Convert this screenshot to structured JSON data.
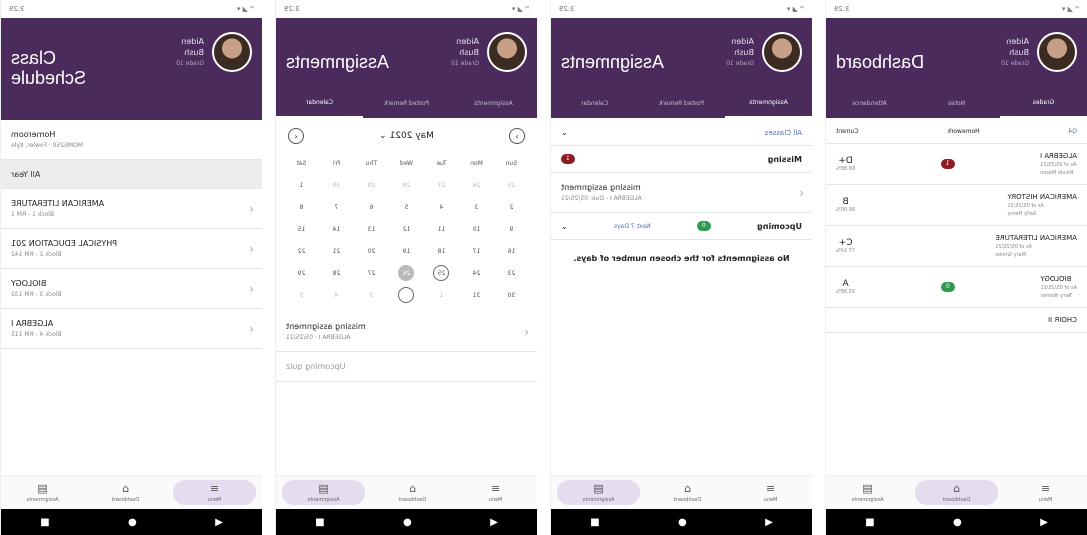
{
  "status": {
    "left": "ᴹ ◢ ▾",
    "right": "3:29"
  },
  "user": {
    "first": "Aiden",
    "last": "Bush",
    "grade": "Grade 10"
  },
  "screen1": {
    "title_line1": "Class",
    "title_line2": "Schedule",
    "homeroom": {
      "name": "Homeroom",
      "sub": "MOMS250 · Fowler, Kyle"
    },
    "term": "All Year",
    "classes": [
      {
        "name": "AMERICAN LITERATURE",
        "sub": "Block 1 - RM 1"
      },
      {
        "name": "PHYSICAL EDUCATION 201",
        "sub": "Block 2 - RM 142"
      },
      {
        "name": "BIOLOGY",
        "sub": "Block 3 - RM 132"
      },
      {
        "name": "ALGEBRA I",
        "sub": "Block 4 - RM 115"
      }
    ],
    "nav": [
      "Assignments",
      "Dashboard",
      "Menu"
    ]
  },
  "screen2": {
    "title": "Assignments",
    "tabs": [
      "Calendar",
      "Posted Remark",
      "Assignments"
    ],
    "month": "May 2021",
    "weekdays": [
      "Sun",
      "Mon",
      "Tue",
      "Wed",
      "Thu",
      "Fri",
      "Sat"
    ],
    "days": [
      {
        "d": "25",
        "s": "faded"
      },
      {
        "d": "26",
        "s": "faded"
      },
      {
        "d": "27",
        "s": "faded"
      },
      {
        "d": "28",
        "s": "faded"
      },
      {
        "d": "29",
        "s": "faded"
      },
      {
        "d": "30",
        "s": "faded"
      },
      {
        "d": "1",
        "s": ""
      },
      {
        "d": "2",
        "s": ""
      },
      {
        "d": "3",
        "s": ""
      },
      {
        "d": "4",
        "s": ""
      },
      {
        "d": "5",
        "s": ""
      },
      {
        "d": "6",
        "s": ""
      },
      {
        "d": "7",
        "s": ""
      },
      {
        "d": "8",
        "s": ""
      },
      {
        "d": "9",
        "s": ""
      },
      {
        "d": "10",
        "s": ""
      },
      {
        "d": "11",
        "s": ""
      },
      {
        "d": "12",
        "s": ""
      },
      {
        "d": "13",
        "s": ""
      },
      {
        "d": "14",
        "s": ""
      },
      {
        "d": "15",
        "s": ""
      },
      {
        "d": "16",
        "s": ""
      },
      {
        "d": "17",
        "s": ""
      },
      {
        "d": "18",
        "s": ""
      },
      {
        "d": "19",
        "s": ""
      },
      {
        "d": "20",
        "s": ""
      },
      {
        "d": "21",
        "s": ""
      },
      {
        "d": "22",
        "s": ""
      },
      {
        "d": "23",
        "s": ""
      },
      {
        "d": "24",
        "s": ""
      },
      {
        "d": "25",
        "s": "ring"
      },
      {
        "d": "26",
        "s": "sel"
      },
      {
        "d": "27",
        "s": ""
      },
      {
        "d": "28",
        "s": ""
      },
      {
        "d": "29",
        "s": ""
      },
      {
        "d": "30",
        "s": ""
      },
      {
        "d": "31",
        "s": ""
      },
      {
        "d": "1",
        "s": "faded"
      },
      {
        "d": "2",
        "s": "ring-empty"
      },
      {
        "d": "3",
        "s": "faded"
      },
      {
        "d": "4",
        "s": "faded"
      },
      {
        "d": "5",
        "s": "faded"
      }
    ],
    "item": {
      "name": "missing assignment",
      "sub": "ALGEBRA I · 05/25/21"
    },
    "item2": "Upcoming quiz",
    "nav": [
      "Assignments",
      "Dashboard",
      "Menu"
    ]
  },
  "screen3": {
    "title": "Assignments",
    "tabs": [
      "Calendar",
      "Posted Remark",
      "Assignments"
    ],
    "filter": "All Classes",
    "missing_label": "Missing",
    "missing_count": "1",
    "missing_item": {
      "name": "missing assignment",
      "sub": "ALGEBRA I - Due: 05/25/21"
    },
    "upcoming_label": "Upcoming",
    "upcoming_count": "0",
    "upcoming_range": "Next 7 Days",
    "empty_msg": "No assignments for the chosen number of days.",
    "nav": [
      "Assignments",
      "Dashboard",
      "Menu"
    ]
  },
  "screen4": {
    "title": "Dashboard",
    "tabs": [
      "Grades",
      "Notes",
      "Attendance"
    ],
    "filters": [
      "Q4",
      "Homework",
      "Current"
    ],
    "grades": [
      {
        "course": "ALGEBRA I",
        "meta1": "As of 05/25/21",
        "meta2": "Nicole Mason",
        "grade": "D+",
        "pct": "68.88%",
        "badge": "1",
        "badge_color": "red"
      },
      {
        "course": "AMERICAN HISTORY",
        "meta1": "As of 05/25/21",
        "meta2": "Kelly Henry",
        "grade": "B",
        "pct": "86.00%",
        "badge": "",
        "badge_color": ""
      },
      {
        "course": "AMERICAN LITERATURE",
        "meta1": "As of 05/25/21",
        "meta2": "Mary Smiles",
        "grade": "C+",
        "pct": "77.14%",
        "badge": "",
        "badge_color": ""
      },
      {
        "course": "BIOLOGY",
        "meta1": "As of 05/25/21",
        "meta2": "Terry Warren",
        "grade": "A",
        "pct": "93.88%",
        "badge": "0",
        "badge_color": "green"
      }
    ],
    "partial": "CHOIR II",
    "nav": [
      "Assignments",
      "Dashboard",
      "Menu"
    ]
  }
}
